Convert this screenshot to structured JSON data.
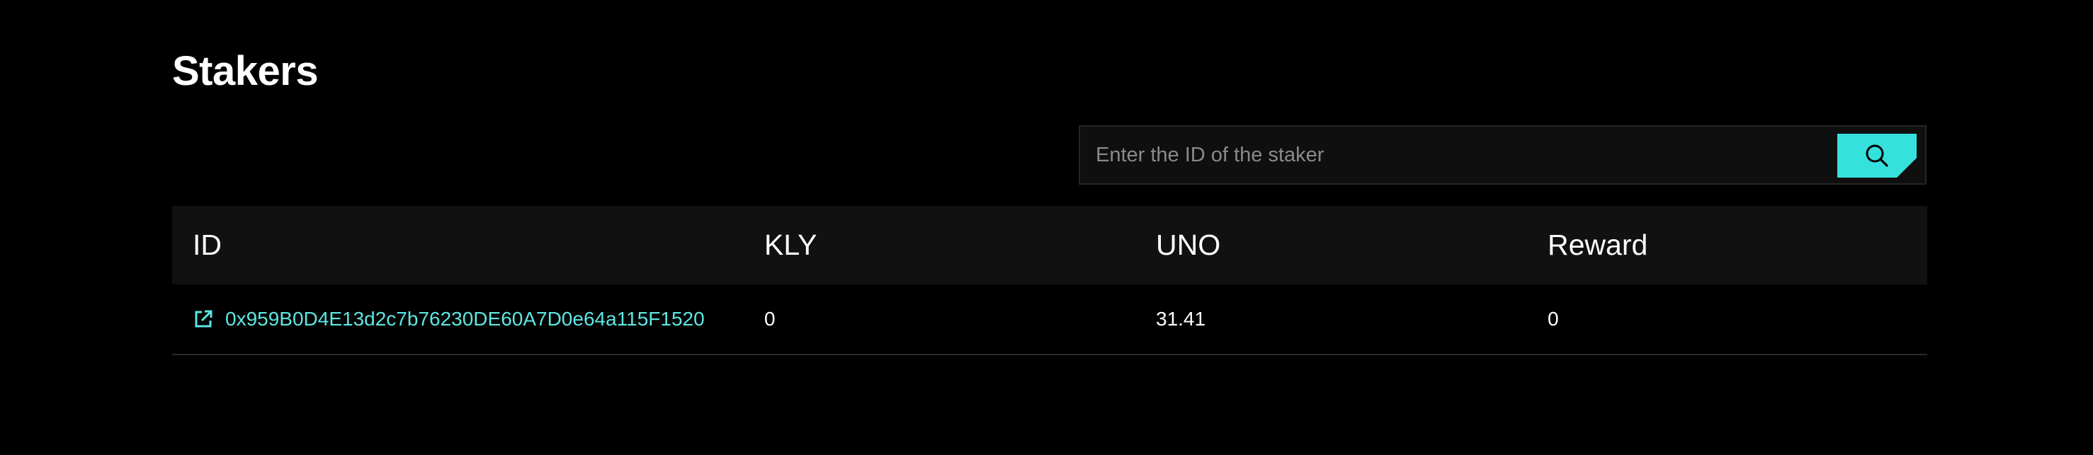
{
  "page": {
    "title": "Stakers"
  },
  "search": {
    "placeholder": "Enter the ID of the staker",
    "value": "",
    "button_icon": "search-icon"
  },
  "table": {
    "columns": [
      "ID",
      "KLY",
      "UNO",
      "Reward"
    ],
    "rows": [
      {
        "id": "0x959B0D4E13d2c7b76230DE60A7D0e64a115F1520",
        "kly": "0",
        "uno": "31.41",
        "reward": "0",
        "link_icon": "external-link-icon"
      }
    ]
  },
  "colors": {
    "background": "#000000",
    "accent": "#35e1dd",
    "link": "#5ee6e3",
    "header_bg": "#111111"
  }
}
